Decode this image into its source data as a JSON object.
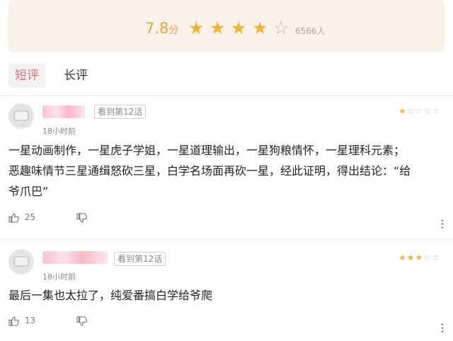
{
  "header": {
    "score": "7.8",
    "score_unit": "分",
    "star_rating": 4,
    "stars_total": 5,
    "rating_count": "6566人",
    "accent_color": "#f2b233"
  },
  "tabs": [
    {
      "label": "短评",
      "active": true
    },
    {
      "label": "长评",
      "active": false
    }
  ],
  "reviews": [
    {
      "progress_badge": "看到第12话",
      "time": "18小时前",
      "stars": 1,
      "lines": [
        "一星动画制作，一星虎子学姐，一星道理输出，一星狗粮情怀，一星理科元素；",
        "恶趣味情节三星通缉怒砍三星，白学名场面再砍一星，经此证明，得出结论：“给",
        "爷爪巴”"
      ],
      "likes": "25"
    },
    {
      "progress_badge": "看到第12话",
      "time": "18小时前",
      "stars": 3,
      "lines": [
        "最后一集也太拉了，纯爱番搞白学给爷爬"
      ],
      "likes": "13"
    }
  ]
}
